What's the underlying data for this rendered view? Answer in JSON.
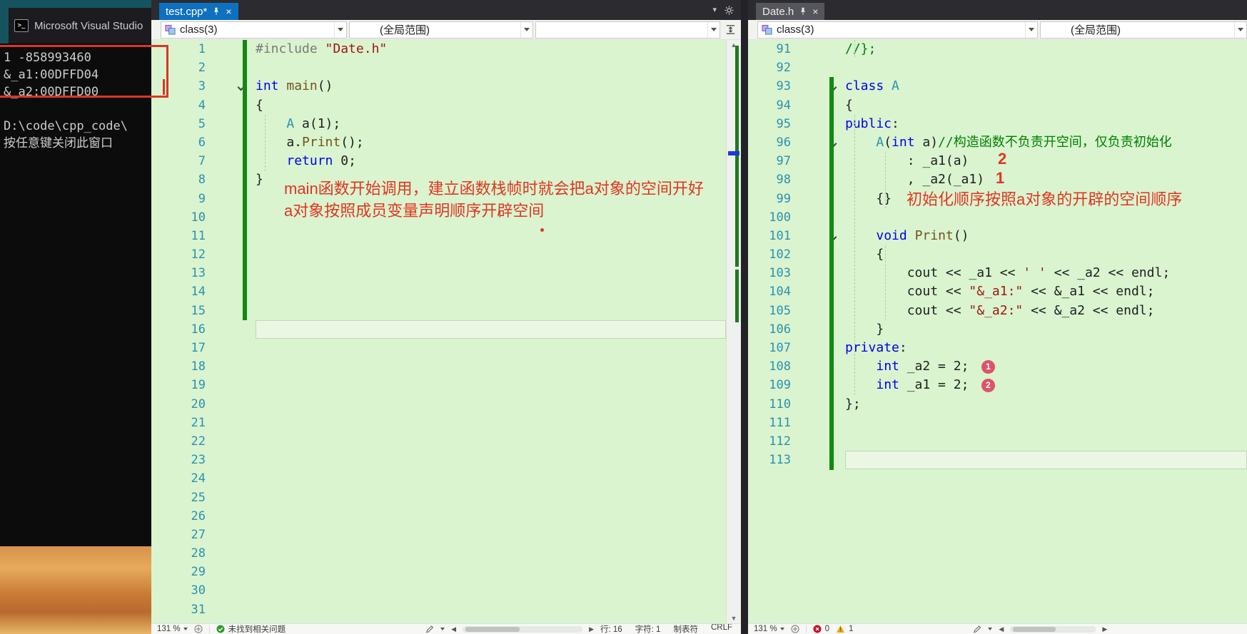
{
  "console": {
    "title": "Microsoft Visual Studio",
    "lines": [
      "1 -858993460",
      "&_a1:00DFFD04",
      "&_a2:00DFFD00",
      "",
      "D:\\code\\cpp_code\\",
      "按任意键关闭此窗口"
    ]
  },
  "tabs": {
    "editor1": {
      "title": "test.cpp*"
    },
    "editor2": {
      "title": "Date.h"
    }
  },
  "nav1": {
    "scope": "class(3)",
    "global": "(全局范围)",
    "member": ""
  },
  "nav2": {
    "scope": "class(3)",
    "global": "(全局范围)"
  },
  "code1": {
    "current_line": 16,
    "lines": [
      {
        "n": 1,
        "t": [
          [
            "pp",
            "#include "
          ],
          [
            "str",
            "\"Date.h\""
          ]
        ]
      },
      {
        "n": 2
      },
      {
        "n": 3,
        "fold": true,
        "t": [
          [
            "kw",
            "int"
          ],
          [
            "pl",
            " "
          ],
          [
            "fn",
            "main"
          ],
          [
            "pl",
            "()"
          ]
        ]
      },
      {
        "n": 4,
        "t": [
          [
            "pl",
            "{"
          ]
        ]
      },
      {
        "n": 5,
        "t": [
          [
            "pl",
            "    "
          ],
          [
            "ty",
            "A"
          ],
          [
            "pl",
            " a(1);"
          ]
        ]
      },
      {
        "n": 6,
        "t": [
          [
            "pl",
            "    a."
          ],
          [
            "fn",
            "Print"
          ],
          [
            "pl",
            "();"
          ]
        ]
      },
      {
        "n": 7,
        "t": [
          [
            "pl",
            "    "
          ],
          [
            "kw",
            "return"
          ],
          [
            "pl",
            " 0;"
          ]
        ]
      },
      {
        "n": 8,
        "t": [
          [
            "pl",
            "}"
          ]
        ]
      },
      {
        "n": 9
      },
      {
        "n": 10
      },
      {
        "n": 11
      },
      {
        "n": 12
      },
      {
        "n": 13
      },
      {
        "n": 14
      },
      {
        "n": 15
      },
      {
        "n": 16
      },
      {
        "n": 17
      },
      {
        "n": 18
      },
      {
        "n": 19
      },
      {
        "n": 20
      },
      {
        "n": 21
      },
      {
        "n": 22
      },
      {
        "n": 23
      },
      {
        "n": 24
      },
      {
        "n": 25
      },
      {
        "n": 26
      },
      {
        "n": 27
      },
      {
        "n": 28
      },
      {
        "n": 29
      },
      {
        "n": 30
      },
      {
        "n": 31
      }
    ]
  },
  "code2": {
    "current_line": 113,
    "lines": [
      {
        "n": 91,
        "t": [
          [
            "cm",
            "//};"
          ]
        ]
      },
      {
        "n": 92
      },
      {
        "n": 93,
        "fold": true,
        "t": [
          [
            "kw",
            "class"
          ],
          [
            "pl",
            " "
          ],
          [
            "ty",
            "A"
          ]
        ]
      },
      {
        "n": 94,
        "t": [
          [
            "pl",
            "{"
          ]
        ]
      },
      {
        "n": 95,
        "t": [
          [
            "kw",
            "public"
          ],
          [
            "pl",
            ":"
          ]
        ]
      },
      {
        "n": 96,
        "fold": true,
        "t": [
          [
            "pl",
            "    "
          ],
          [
            "ty",
            "A"
          ],
          [
            "pl",
            "("
          ],
          [
            "kw",
            "int"
          ],
          [
            "pl",
            " a)"
          ],
          [
            "cm",
            "//构造函数不负责开空间，仅负责初始化"
          ]
        ]
      },
      {
        "n": 97,
        "t": [
          [
            "pl",
            "        : _a1(a)"
          ]
        ]
      },
      {
        "n": 98,
        "t": [
          [
            "pl",
            "        , _a2(_a1)"
          ]
        ]
      },
      {
        "n": 99,
        "t": [
          [
            "pl",
            "    {}"
          ]
        ]
      },
      {
        "n": 100
      },
      {
        "n": 101,
        "fold": true,
        "t": [
          [
            "pl",
            "    "
          ],
          [
            "kw",
            "void"
          ],
          [
            "pl",
            " "
          ],
          [
            "fn",
            "Print"
          ],
          [
            "pl",
            "()"
          ]
        ]
      },
      {
        "n": 102,
        "t": [
          [
            "pl",
            "    {"
          ]
        ]
      },
      {
        "n": 103,
        "t": [
          [
            "pl",
            "        cout << _a1 << "
          ],
          [
            "str",
            "' '"
          ],
          [
            "pl",
            " << _a2 << endl;"
          ]
        ]
      },
      {
        "n": 104,
        "t": [
          [
            "pl",
            "        cout << "
          ],
          [
            "str",
            "\"&_a1:\""
          ],
          [
            "pl",
            " << &_a1 << endl;"
          ]
        ]
      },
      {
        "n": 105,
        "t": [
          [
            "pl",
            "        cout << "
          ],
          [
            "str",
            "\"&_a2:\""
          ],
          [
            "pl",
            " << &_a2 << endl;"
          ]
        ]
      },
      {
        "n": 106,
        "t": [
          [
            "pl",
            "    }"
          ]
        ]
      },
      {
        "n": 107,
        "t": [
          [
            "kw",
            "private"
          ],
          [
            "pl",
            ":"
          ]
        ]
      },
      {
        "n": 108,
        "t": [
          [
            "pl",
            "    "
          ],
          [
            "kw",
            "int"
          ],
          [
            "pl",
            " _a2 = 2;"
          ]
        ]
      },
      {
        "n": 109,
        "t": [
          [
            "pl",
            "    "
          ],
          [
            "kw",
            "int"
          ],
          [
            "pl",
            " _a1 = 2;"
          ]
        ]
      },
      {
        "n": 110,
        "t": [
          [
            "pl",
            "};"
          ]
        ]
      },
      {
        "n": 111
      },
      {
        "n": 112
      },
      {
        "n": 113
      }
    ]
  },
  "annotations": {
    "ed1_note1": "main函数开始调用，建立函数栈帧时就会把a对象的空间开好",
    "ed1_note2": "a对象按照成员变量声明顺序开辟空间",
    "ed2_note": "初始化顺序按照a对象的开辟的空间顺序",
    "ed2_num97": "2",
    "ed2_num98": "1",
    "badge108": "1",
    "badge109": "2"
  },
  "status1": {
    "zoom": "131 %",
    "health": "未找到相关问题",
    "line": "行: 16",
    "col": "字符: 1",
    "indent": "制表符",
    "eol": "CRLF"
  },
  "status2": {
    "zoom": "131 %",
    "errors": "0",
    "warnings": "1"
  }
}
